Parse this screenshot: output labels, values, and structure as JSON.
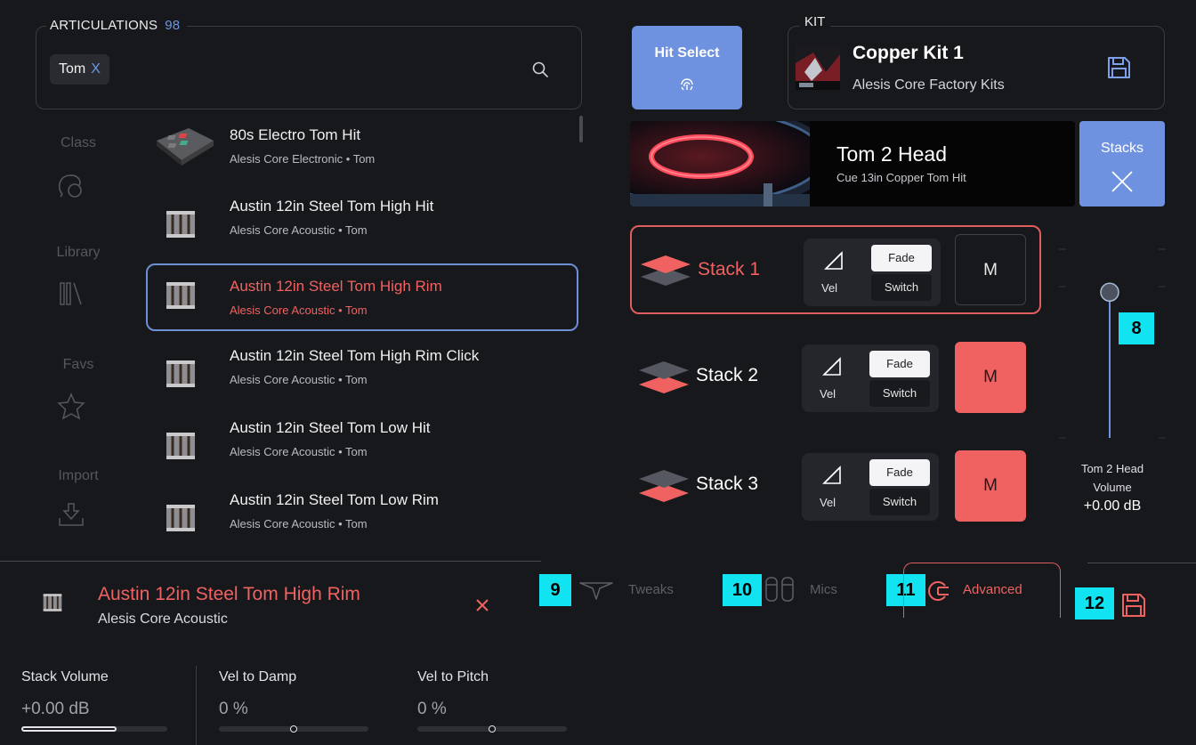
{
  "articulations": {
    "title": "ARTICULATIONS",
    "count": "98",
    "filter_chip": "Tom",
    "filter_chip_remove": "X",
    "search_icon": "search-icon"
  },
  "sidebar": {
    "items": [
      {
        "label": "Class",
        "icon": "class-icon"
      },
      {
        "label": "Library",
        "icon": "library-icon"
      },
      {
        "label": "Favs",
        "icon": "star-icon"
      },
      {
        "label": "Import",
        "icon": "import-icon"
      }
    ]
  },
  "list": {
    "items": [
      {
        "title": "80s Electro Tom Hit",
        "sub": "Alesis Core Electronic • Tom",
        "thumb": "drum-pad-thumb"
      },
      {
        "title": "Austin 12in Steel Tom High Hit",
        "sub": "Alesis Core Acoustic • Tom",
        "thumb": "steel-drum-thumb"
      },
      {
        "title": "Austin 12in Steel Tom High Rim",
        "sub": "Alesis Core Acoustic • Tom",
        "thumb": "steel-drum-thumb",
        "selected": true
      },
      {
        "title": "Austin 12in Steel Tom High Rim Click",
        "sub": "Alesis Core Acoustic • Tom",
        "thumb": "steel-drum-thumb"
      },
      {
        "title": "Austin 12in Steel Tom Low Hit",
        "sub": "Alesis Core Acoustic • Tom",
        "thumb": "steel-drum-thumb"
      },
      {
        "title": "Austin 12in Steel Tom Low Rim",
        "sub": "Alesis Core Acoustic • Tom",
        "thumb": "steel-drum-thumb"
      }
    ]
  },
  "hit_select": {
    "label": "Hit Select",
    "icon": "fingerprint-icon"
  },
  "kit": {
    "label": "KIT",
    "name": "Copper Kit 1",
    "library": "Alesis Core Factory Kits",
    "save_icon": "save-icon"
  },
  "pad": {
    "title": "Tom 2 Head",
    "sub": "Cue 13in Copper Tom Hit"
  },
  "stacks_button": {
    "label": "Stacks",
    "icon": "close-icon"
  },
  "stacks": [
    {
      "name": "Stack 1",
      "vel": "Vel",
      "fade": "Fade",
      "switch": "Switch",
      "mute": "M",
      "muted": false,
      "active": true
    },
    {
      "name": "Stack 2",
      "vel": "Vel",
      "fade": "Fade",
      "switch": "Switch",
      "mute": "M",
      "muted": true,
      "active": false
    },
    {
      "name": "Stack 3",
      "vel": "Vel",
      "fade": "Fade",
      "switch": "Switch",
      "mute": "M",
      "muted": true,
      "active": false
    }
  ],
  "volume": {
    "caption_line1": "Tom 2 Head",
    "caption_line2": "Volume",
    "value": "+0.00 dB",
    "fader_level": 0.92
  },
  "badges": [
    "8",
    "9",
    "10",
    "11",
    "12"
  ],
  "selected": {
    "name": "Austin 12in Steel Tom High Rim",
    "library": "Alesis Core Acoustic",
    "close_icon": "close-icon"
  },
  "tabs": [
    {
      "label": "Tweaks",
      "icon": "tweaks-icon"
    },
    {
      "label": "Mics",
      "icon": "mics-icon"
    },
    {
      "label": "Advanced",
      "icon": "advanced-icon",
      "active": true
    }
  ],
  "params": [
    {
      "label": "Stack Volume",
      "value": "+0.00 dB",
      "level": 0.65
    },
    {
      "label": "Vel to Damp",
      "value": "0 %",
      "level": 0.5
    },
    {
      "label": "Vel to Pitch",
      "value": "0 %",
      "level": 0.5
    }
  ],
  "colors": {
    "accent_blue": "#6f92e0",
    "accent_red": "#f06262",
    "badge": "#12e3f0",
    "background": "#17181b"
  }
}
